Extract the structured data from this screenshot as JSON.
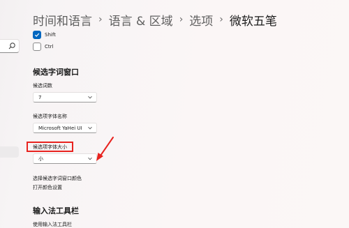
{
  "breadcrumb": [
    {
      "label": "时间和语言"
    },
    {
      "label": "语言 & 区域"
    },
    {
      "label": "选项"
    },
    {
      "label": "微软五笔"
    }
  ],
  "breadcrumb_separator": "›",
  "checkboxes": [
    {
      "label": "Shift",
      "checked": true
    },
    {
      "label": "Ctrl",
      "checked": false
    }
  ],
  "candidate_window": {
    "title": "候选字词窗口",
    "count_label": "候选词数",
    "count_value": "7",
    "font_label": "候选项字体名称",
    "font_value": "Microsoft YaHei UI",
    "size_label": "候选项字体大小",
    "size_value": "小",
    "color_label": "选择候选字词窗口颜色",
    "color_link": "打开颜色设置"
  },
  "toolbar_section": {
    "title": "输入法工具栏",
    "use_label": "使用输入法工具栏"
  },
  "colors": {
    "accent": "#0067c0",
    "annotation": "#e8231f"
  },
  "icons": {
    "search": "search-icon",
    "dropdown": "chevron-down-icon",
    "check": "check-icon"
  }
}
